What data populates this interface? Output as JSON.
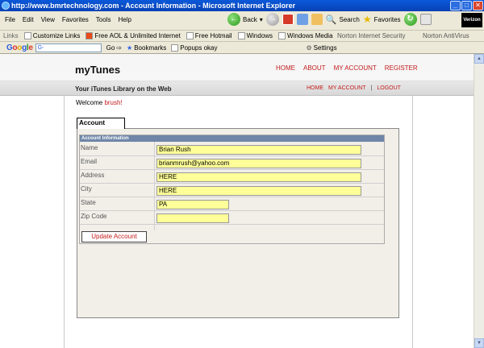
{
  "window": {
    "title": "http://www.bmrtechnology.com - Account Information - Microsoft Internet Explorer"
  },
  "menu": {
    "items": [
      "File",
      "Edit",
      "View",
      "Favorites",
      "Tools",
      "Help"
    ]
  },
  "toolbar": {
    "back_label": "Back",
    "search_label": "Search",
    "favorites_label": "Favorites",
    "brand_label": "Verizon"
  },
  "links_bar": {
    "label": "Links",
    "items": [
      "Customize Links",
      "Free AOL & Unlimited Internet",
      "Free Hotmail",
      "Windows",
      "Windows Media"
    ],
    "norton_label": "Norton Internet Security",
    "antivirus_label": "Norton AntiVirus"
  },
  "google_bar": {
    "logo": "Google",
    "search_value": "G-",
    "go_label": "Go",
    "bookmarks_label": "Bookmarks",
    "popups_label": "Popups okay",
    "settings_label": "Settings"
  },
  "site": {
    "title": "myTunes",
    "nav": [
      "HOME",
      "ABOUT",
      "MY ACCOUNT",
      "REGISTER"
    ],
    "tagline": "Your iTunes Library on the Web",
    "subnav": [
      "HOME",
      "MY ACCOUNT",
      "LOGOUT"
    ],
    "subnav_sep": "|",
    "welcome_prefix": "Welcome",
    "username": "brush!"
  },
  "account": {
    "tab_label": "Account",
    "section_header": "Account Information",
    "fields": [
      {
        "label": "Name",
        "value": "Brian Rush"
      },
      {
        "label": "Email",
        "value": "brianmrush@yahoo.com"
      },
      {
        "label": "Address",
        "value": "HERE"
      },
      {
        "label": "City",
        "value": "HERE"
      },
      {
        "label": "State",
        "value": "PA"
      },
      {
        "label": "Zip Code",
        "value": ""
      }
    ],
    "update_button": "Update Account"
  },
  "colors": {
    "accent_red": "#c41c1c",
    "input_yellow": "#ffff99",
    "section_header_blue": "#6f86a8"
  }
}
